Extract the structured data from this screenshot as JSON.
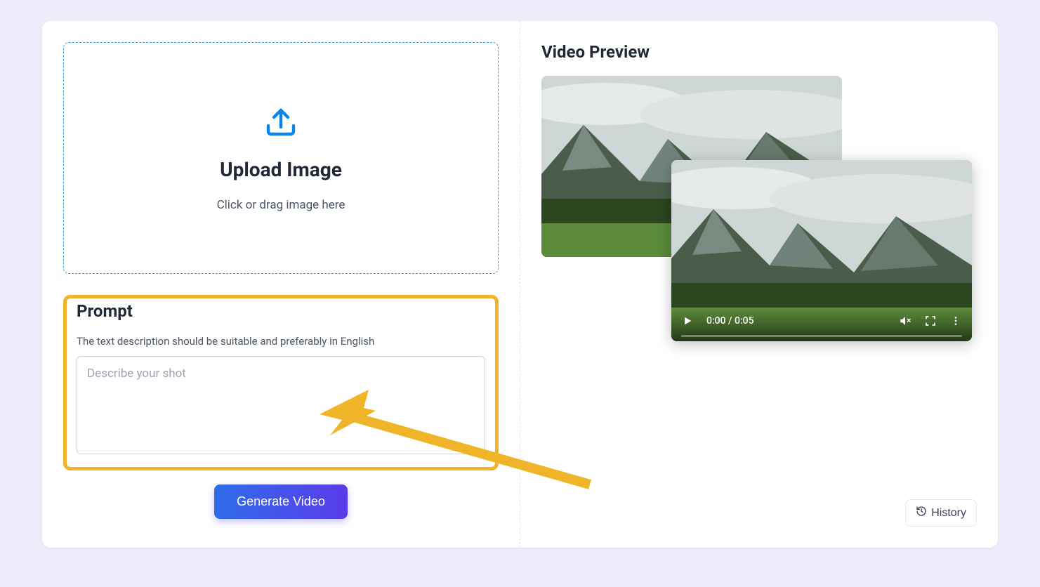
{
  "upload": {
    "title": "Upload Image",
    "subtitle": "Click or drag image here"
  },
  "prompt": {
    "title": "Prompt",
    "hint": "The text description should be suitable and preferably in English",
    "placeholder": "Describe your shot",
    "value": ""
  },
  "actions": {
    "generate": "Generate Video",
    "history": "History"
  },
  "preview": {
    "title": "Video Preview",
    "time": "0:00 / 0:05"
  },
  "annotation": {
    "highlight_color": "#f0b429"
  }
}
